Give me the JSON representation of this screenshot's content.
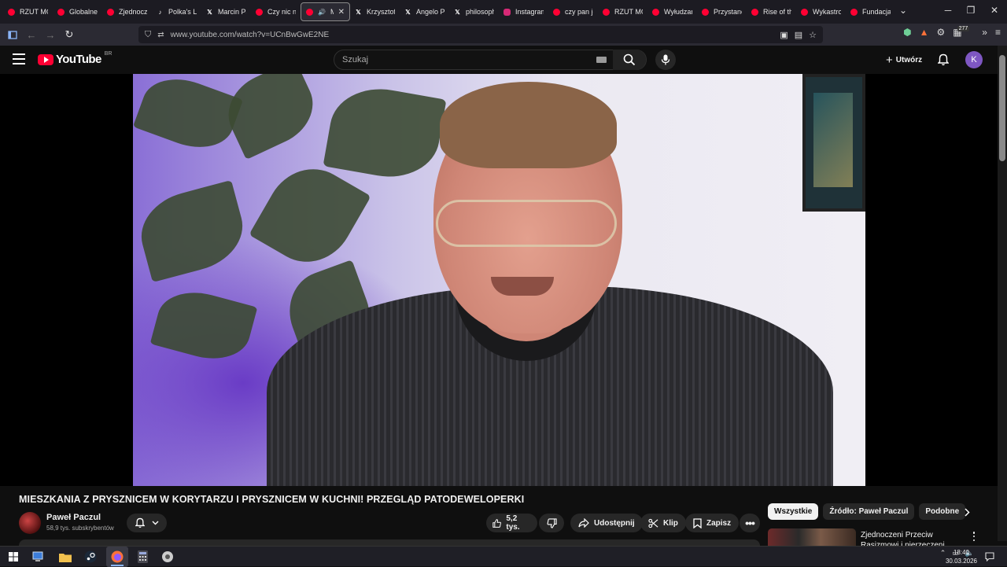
{
  "browser": {
    "tabs": [
      {
        "title": "RZUT MO",
        "icon": "youtube-icon"
      },
      {
        "title": "Globalne",
        "icon": "youtube-icon"
      },
      {
        "title": "Zjednocz",
        "icon": "youtube-icon"
      },
      {
        "title": "Polka's Li",
        "icon": "tiktok-icon"
      },
      {
        "title": "Marcin Pa",
        "icon": "x-icon"
      },
      {
        "title": "Czy nic n",
        "icon": "youtube-icon"
      },
      {
        "title": "MIE",
        "icon": "youtube-icon",
        "active": true
      },
      {
        "title": "Krzysztof",
        "icon": "x-icon"
      },
      {
        "title": "Angelo Pl",
        "icon": "x-icon"
      },
      {
        "title": "philosoph",
        "icon": "x-icon"
      },
      {
        "title": "Instagram",
        "icon": "instagram-icon"
      },
      {
        "title": "czy pan je",
        "icon": "youtube-icon"
      },
      {
        "title": "RZUT MO",
        "icon": "youtube-icon"
      },
      {
        "title": "Wyłudzar",
        "icon": "youtube-icon"
      },
      {
        "title": "Przystane",
        "icon": "youtube-icon"
      },
      {
        "title": "Rise of th",
        "icon": "youtube-icon"
      },
      {
        "title": "Wykastro",
        "icon": "youtube-icon"
      },
      {
        "title": "Fundacja",
        "icon": "youtube-icon"
      }
    ],
    "url": "www.youtube.com/watch?v=UCnBwGwE2NE",
    "extension_badge": "277"
  },
  "youtube": {
    "logo_text": "YouTube",
    "country_code": "BR",
    "search_placeholder": "Szukaj",
    "create_label": "Utwórz",
    "avatar_letter": "K"
  },
  "video": {
    "title": "MIESZKANIA Z PRYSZNICEM W KORYTARZU I PRYSZNICEM W KUCHNI! PRZEGLĄD PATODEWELOPERKI",
    "channel_name": "Paweł Paczul",
    "subscribers": "58,9 tys. subskrybentów",
    "likes": "5,2 tys.",
    "share_label": "Udostępnij",
    "clip_label": "Klip",
    "save_label": "Zapisz"
  },
  "sidebar": {
    "chips": [
      {
        "label": "Wszystkie",
        "selected": true
      },
      {
        "label": "Źródło: Paweł Paczul",
        "selected": false
      },
      {
        "label": "Podobne",
        "selected": false
      }
    ],
    "recommendation_title": "Zjednoczeni Przeciw Rasizmowi i nierzeczeni"
  },
  "taskbar": {
    "time": "18:40",
    "date": "30.03.2026"
  },
  "colors": {
    "youtube_red": "#ff0033",
    "avatar_purple": "#7e57c2",
    "background": "#0f0f0f"
  }
}
